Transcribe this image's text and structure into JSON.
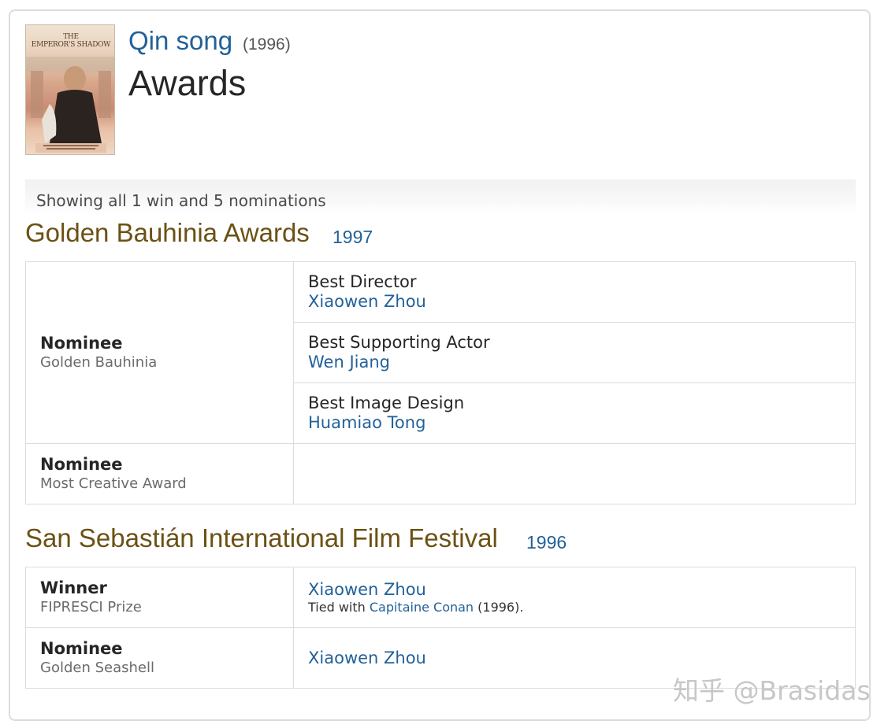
{
  "poster": {
    "title_line1": "THE",
    "title_line2": "EMPEROR'S SHADOW"
  },
  "header": {
    "title_link": "Qin song",
    "year": "(1996)",
    "page_title": "Awards"
  },
  "summary": "Showing all 1 win and 5 nominations",
  "events": [
    {
      "name": "Golden Bauhinia Awards",
      "year": "1997",
      "rows": [
        {
          "status": "Nominee",
          "category": "Golden Bauhinia",
          "awards": [
            {
              "category": "Best Director",
              "person": "Xiaowen Zhou"
            },
            {
              "category": "Best Supporting Actor",
              "person": "Wen Jiang"
            },
            {
              "category": "Best Image Design",
              "person": "Huamiao Tong"
            }
          ]
        },
        {
          "status": "Nominee",
          "category": "Most Creative Award",
          "awards": []
        }
      ]
    },
    {
      "name": "San Sebastián International Film Festival",
      "year": "1996",
      "rows": [
        {
          "status": "Winner",
          "category": "FIPRESCI Prize",
          "person": "Xiaowen Zhou",
          "tie_prefix": "Tied with ",
          "tie_link": "Capitaine Conan",
          "tie_suffix": " (1996)."
        },
        {
          "status": "Nominee",
          "category": "Golden Seashell",
          "person": "Xiaowen Zhou"
        }
      ]
    }
  ],
  "watermark": "知乎 @Brasidas",
  "colors": {
    "link": "#226199",
    "event_title": "#6b5114",
    "border": "#dcdcdc"
  }
}
